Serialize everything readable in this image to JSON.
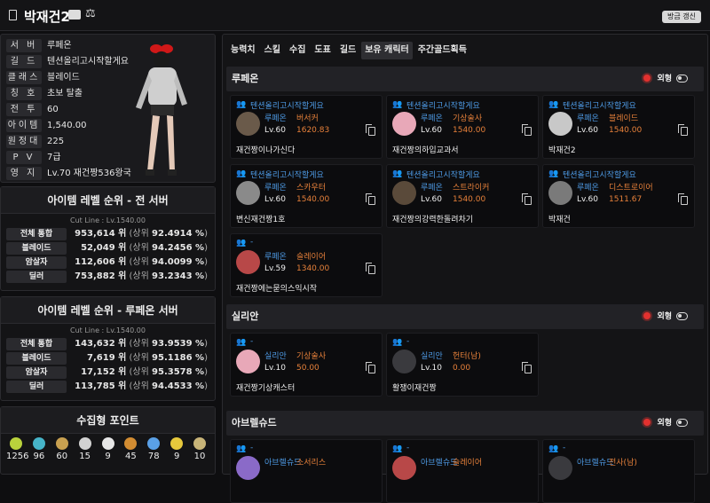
{
  "header": {
    "title": "박재건2",
    "refresh": "방금 갱신"
  },
  "profile": [
    {
      "k": "서 버",
      "v": "루페온"
    },
    {
      "k": "길 드",
      "v": "텐션올리고시작할게요"
    },
    {
      "k": "클래스",
      "v": "블레이드"
    },
    {
      "k": "칭 호",
      "v": "초보 탈출"
    },
    {
      "k": "전 투",
      "v": "60"
    },
    {
      "k": "아이템",
      "v": "1,540.00"
    },
    {
      "k": "원정대",
      "v": "225"
    },
    {
      "k": "P V P",
      "v": "7급"
    },
    {
      "k": "영 지",
      "v": "Lv.70 재건짱536왕국"
    }
  ],
  "rank_all": {
    "title": "아이템 레벨 순위 - 전 서버",
    "cut": "Cut Line : Lv.1540.00",
    "rows": [
      {
        "k": "전체 통합",
        "rank": "953,614 위",
        "pct": "92.4914 %"
      },
      {
        "k": "블레이드",
        "rank": "52,049 위",
        "pct": "94.2456 %"
      },
      {
        "k": "암살자",
        "rank": "112,606 위",
        "pct": "94.0099 %"
      },
      {
        "k": "딜러",
        "rank": "753,882 위",
        "pct": "93.2343 %"
      }
    ]
  },
  "rank_server": {
    "title": "아이템 레벨 순위 - 루페온 서버",
    "cut": "Cut Line : Lv.1540.00",
    "rows": [
      {
        "k": "전체 통합",
        "rank": "143,632 위",
        "pct": "93.9539 %"
      },
      {
        "k": "블레이드",
        "rank": "7,619 위",
        "pct": "95.1186 %"
      },
      {
        "k": "암살자",
        "rank": "17,152 위",
        "pct": "95.3578 %"
      },
      {
        "k": "딜러",
        "rank": "113,785 위",
        "pct": "94.4533 %"
      }
    ]
  },
  "labels": {
    "upper": "(상위",
    "close": ")"
  },
  "points": {
    "title": "수집형 포인트",
    "values": [
      "1256",
      "96",
      "60",
      "15",
      "9",
      "45",
      "78",
      "9",
      "10"
    ],
    "colors": [
      "#b9d23c",
      "#46b4c8",
      "#c8a050",
      "#d2d2d2",
      "#e6e6e6",
      "#d28c32",
      "#5aa0e6",
      "#e6c83c",
      "#c8b478"
    ]
  },
  "tabs": [
    "능력치",
    "스킬",
    "수집",
    "도표",
    "길드",
    "보유 캐릭터",
    "주간골드획득"
  ],
  "active_tab": "보유 캐릭터",
  "section_label": "외형",
  "sections": [
    {
      "name": "루페온",
      "cards": [
        {
          "guild": "텐션올리고시작할게요",
          "server": "루페온",
          "cls": "버서커",
          "lv": "Lv.60",
          "ilvl": "1620.83",
          "name": "재건짱이나가신다",
          "av": "#6a5a4a"
        },
        {
          "guild": "텐션올리고시작할게요",
          "server": "루페온",
          "cls": "기상술사",
          "lv": "Lv.60",
          "ilvl": "1540.00",
          "name": "재건짱의하입교과서",
          "av": "#e8a8b8"
        },
        {
          "guild": "텐션올리고시작할게요",
          "server": "루페온",
          "cls": "블레이드",
          "lv": "Lv.60",
          "ilvl": "1540.00",
          "name": "박재건2",
          "av": "#c8c8c8"
        },
        {
          "guild": "텐션올리고시작할게요",
          "server": "루페온",
          "cls": "스카우터",
          "lv": "Lv.60",
          "ilvl": "1540.00",
          "name": "변신재건짱1호",
          "av": "#8a8a8a"
        },
        {
          "guild": "텐션올리고시작할게요",
          "server": "루페온",
          "cls": "스트라이커",
          "lv": "Lv.60",
          "ilvl": "1540.00",
          "name": "재건짱의강력한돌려차기",
          "av": "#5a4a3a"
        },
        {
          "guild": "텐션올리고시작할게요",
          "server": "루페온",
          "cls": "디스트로이어",
          "lv": "Lv.60",
          "ilvl": "1511.67",
          "name": "박재건",
          "av": "#7a7a7a"
        },
        {
          "guild": "-",
          "server": "루페온",
          "cls": "슬레이어",
          "lv": "Lv.59",
          "ilvl": "1340.00",
          "name": "재건짱에는묻의스익시작",
          "av": "#b84848"
        }
      ]
    },
    {
      "name": "실리안",
      "cards": [
        {
          "guild": "-",
          "server": "실리안",
          "cls": "기상술사",
          "lv": "Lv.10",
          "ilvl": "50.00",
          "name": "재건짱기상캐스터",
          "av": "#e8a8b8"
        },
        {
          "guild": "-",
          "server": "실리안",
          "cls": "헌터(남)",
          "lv": "Lv.10",
          "ilvl": "0.00",
          "name": "활쟁이재건짱",
          "av": "#3a3a3e"
        }
      ]
    },
    {
      "name": "아브렐슈드",
      "cards": [
        {
          "guild": "-",
          "server": "아브렐슈드",
          "cls": "소서리스",
          "lv": "",
          "ilvl": "",
          "name": "",
          "av": "#8a6ac8"
        },
        {
          "guild": "-",
          "server": "아브렐슈드",
          "cls": "슬레이어",
          "lv": "",
          "ilvl": "",
          "name": "",
          "av": "#b84848"
        },
        {
          "guild": "-",
          "server": "아브렐슈드",
          "cls": "전사(남)",
          "lv": "",
          "ilvl": "",
          "name": "",
          "av": "#3a3a3e"
        }
      ]
    }
  ]
}
